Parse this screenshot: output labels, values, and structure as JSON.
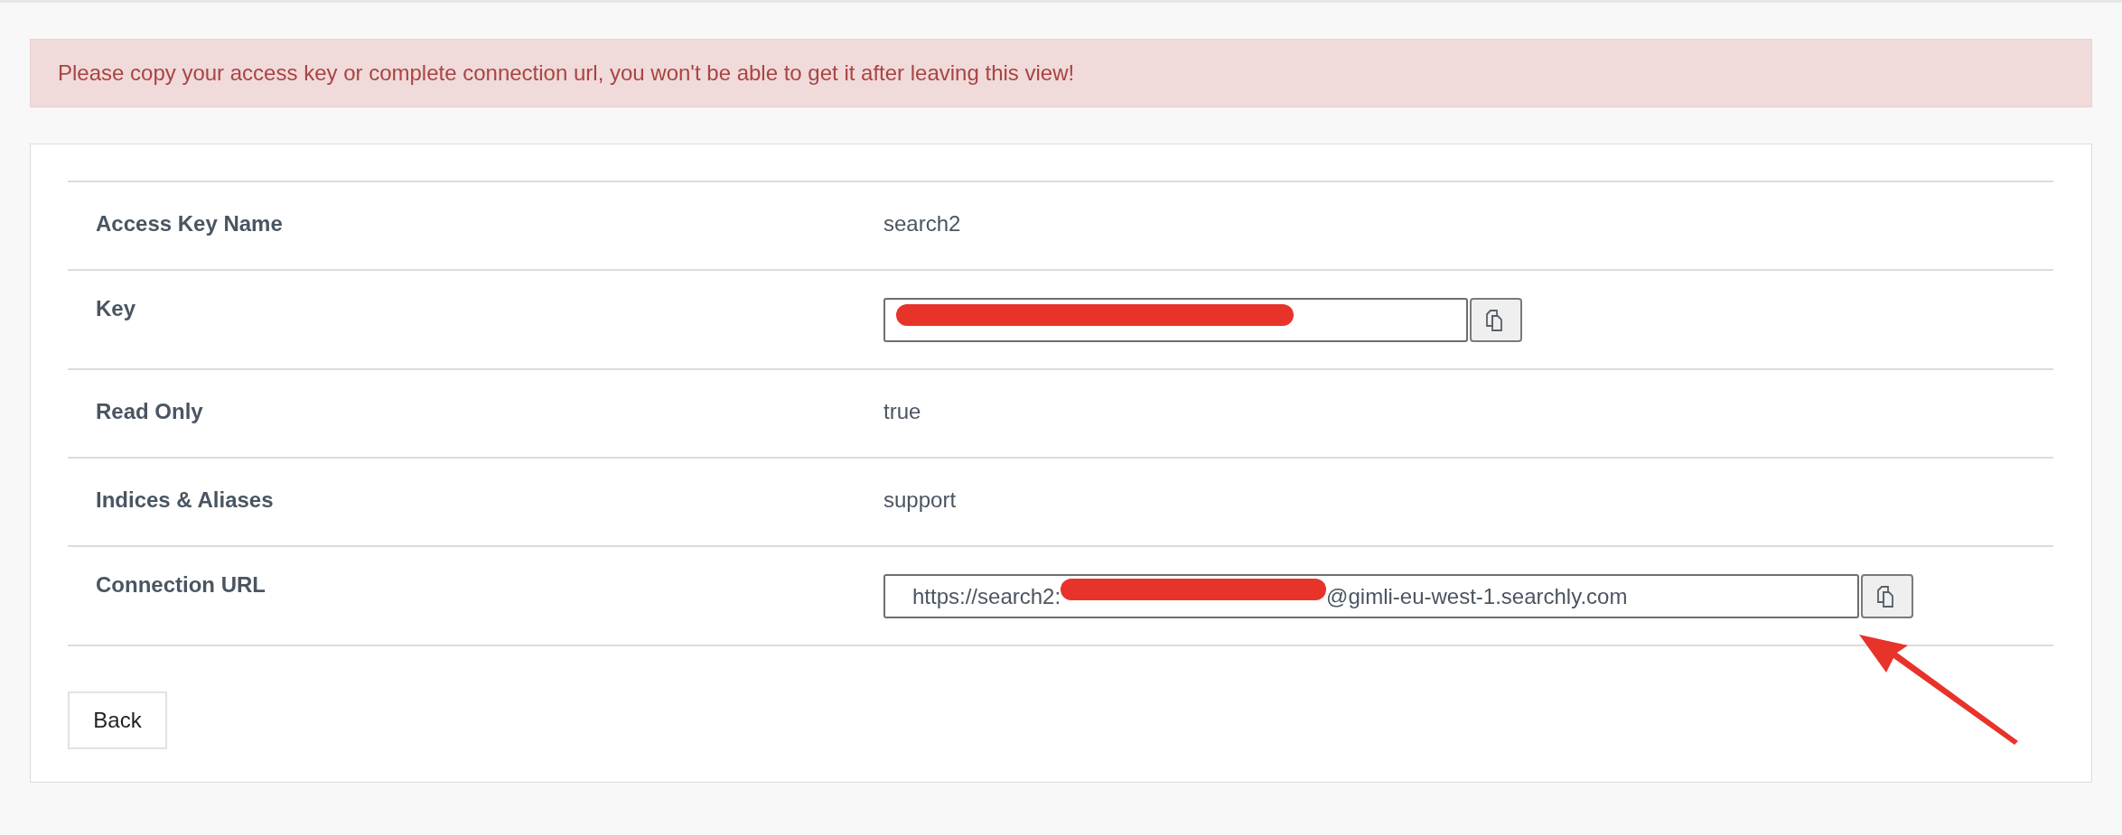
{
  "alert": {
    "message": "Please copy your access key or complete connection url, you won't be able to get it after leaving this view!"
  },
  "details": [
    {
      "kind": "text",
      "label": "Access Key Name",
      "value": "search2"
    },
    {
      "kind": "field",
      "label": "Key",
      "redacted": true
    },
    {
      "kind": "text",
      "label": "Read Only",
      "value": "true"
    },
    {
      "kind": "text",
      "label": "Indices & Aliases",
      "value": "support"
    },
    {
      "kind": "field",
      "label": "Connection URL",
      "redacted": true,
      "value_before": "https://search2:",
      "value_after": "@gimli-eu-west-1.searchly.com",
      "pointed_at": true
    }
  ],
  "buttons": [
    {
      "label": "Back"
    }
  ]
}
